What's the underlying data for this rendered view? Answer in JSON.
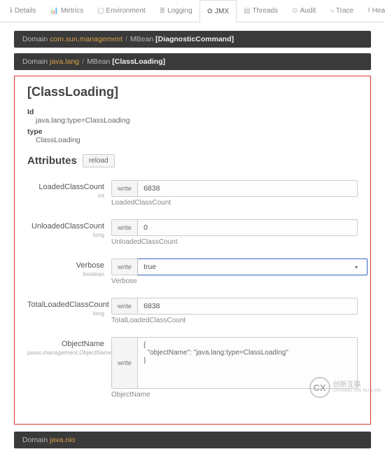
{
  "tabs": [
    {
      "icon": "ℹ",
      "label": "Details"
    },
    {
      "icon": "📊",
      "label": "Metrics"
    },
    {
      "icon": "▢",
      "label": "Environment"
    },
    {
      "icon": "≣",
      "label": "Logging"
    },
    {
      "icon": "✿",
      "label": "JMX",
      "active": true
    },
    {
      "icon": "▤",
      "label": "Threads"
    },
    {
      "icon": "⊙",
      "label": "Audit"
    },
    {
      "icon": "⤷",
      "label": "Trace"
    },
    {
      "icon": "⭳",
      "label": "Heapdump"
    }
  ],
  "breadcrumbs": [
    {
      "domainLabel": "Domain",
      "domainValue": "com.sun.management",
      "mbeanLabel": "MBean",
      "mbeanValue": "[DiagnosticCommand]"
    },
    {
      "domainLabel": "Domain",
      "domainValue": "java.lang",
      "mbeanLabel": "MBean",
      "mbeanValue": "[ClassLoading]"
    }
  ],
  "panel": {
    "title": "[ClassLoading]",
    "idLabel": "Id",
    "idValue": "java.lang:type=ClassLoading",
    "typeLabel": "type",
    "typeValue": "ClassLoading",
    "attributesLabel": "Attributes",
    "reloadLabel": "reload"
  },
  "writeLabel": "write",
  "attrs": [
    {
      "name": "LoadedClassCount",
      "sub": "int",
      "value": "6838",
      "desc": "LoadedClassCount",
      "kind": "input"
    },
    {
      "name": "UnloadedClassCount",
      "sub": "long",
      "value": "0",
      "desc": "UnloadedClassCount",
      "kind": "input"
    },
    {
      "name": "Verbose",
      "sub": "boolean",
      "value": "true",
      "desc": "Verbose",
      "kind": "select"
    },
    {
      "name": "TotalLoadedClassCount",
      "sub": "long",
      "value": "6838",
      "desc": "TotalLoadedClassCount",
      "kind": "input"
    },
    {
      "name": "ObjectName",
      "sub": "javax.management.ObjectName",
      "value": "{\n  \"objectName\": \"java.lang:type=ClassLoading\"\n}",
      "desc": "ObjectName",
      "kind": "textarea"
    }
  ],
  "footer": {
    "domainLabel": "Domain",
    "domainValue": "java.nio"
  },
  "watermark": {
    "logo": "CX",
    "line1": "创新互联",
    "line2": "CHUANG XIN HU LIAN"
  }
}
